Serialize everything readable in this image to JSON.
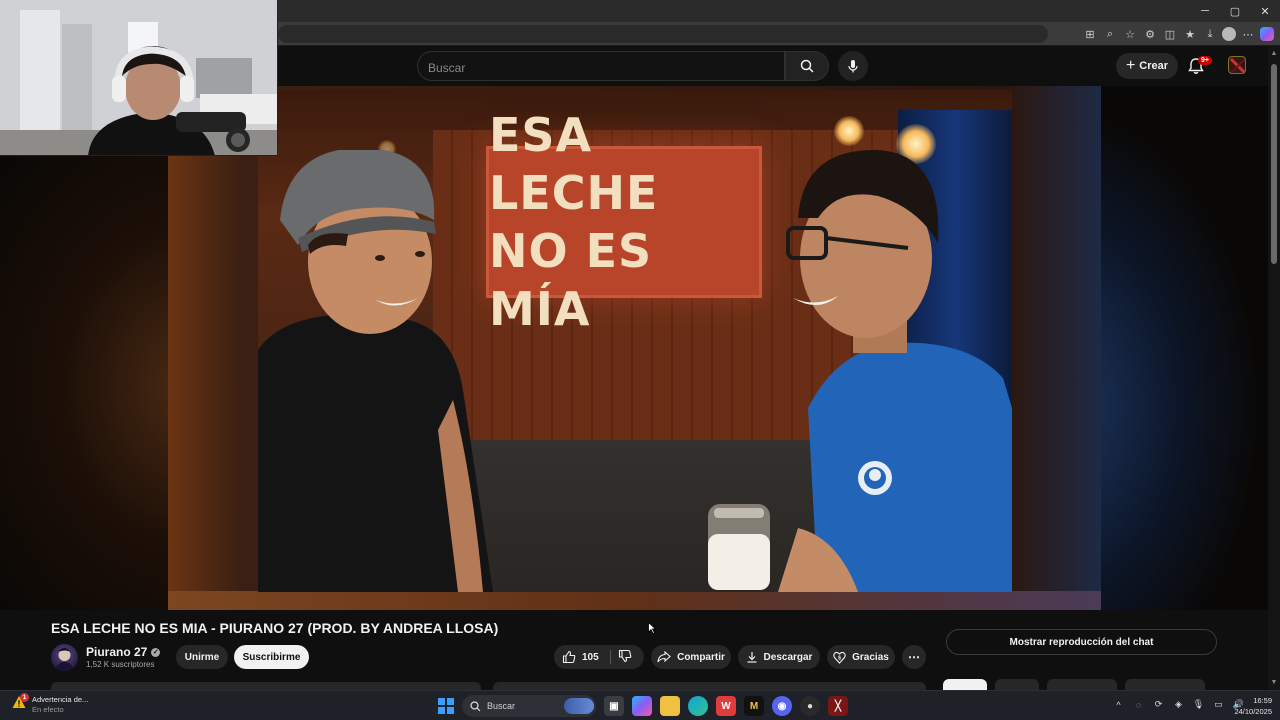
{
  "youtube": {
    "search_placeholder": "Buscar",
    "create_label": "Crear",
    "notification_badge": "9+"
  },
  "video": {
    "sign_line1": "ESA LECHE",
    "sign_line2": "NO ES MÍA",
    "title": "ESA LECHE NO ES MIA - PIURANO 27 (PROD. BY ANDREA LLOSA)"
  },
  "channel": {
    "name": "Piurano 27",
    "subscribers": "1,52 K suscriptores",
    "join_label": "Unirme",
    "subscribe_label": "Suscribirme"
  },
  "actions": {
    "likes": "105",
    "share_label": "Compartir",
    "download_label": "Descargar",
    "thanks_label": "Gracias",
    "more_label": "⋯"
  },
  "chat": {
    "replay_label": "Mostrar reproducción del chat"
  },
  "taskbar": {
    "warning_title": "Advertencia de...",
    "warning_sub": "En efecto",
    "warning_badge": "1",
    "search_label": "Buscar",
    "time": "16:59",
    "date": "24/10/2025"
  },
  "colors": {
    "yt_bg": "#0f0f0f",
    "pill_bg": "#272727",
    "notification_red": "#cc0000",
    "subscribe_bg": "#f1f1f1"
  }
}
